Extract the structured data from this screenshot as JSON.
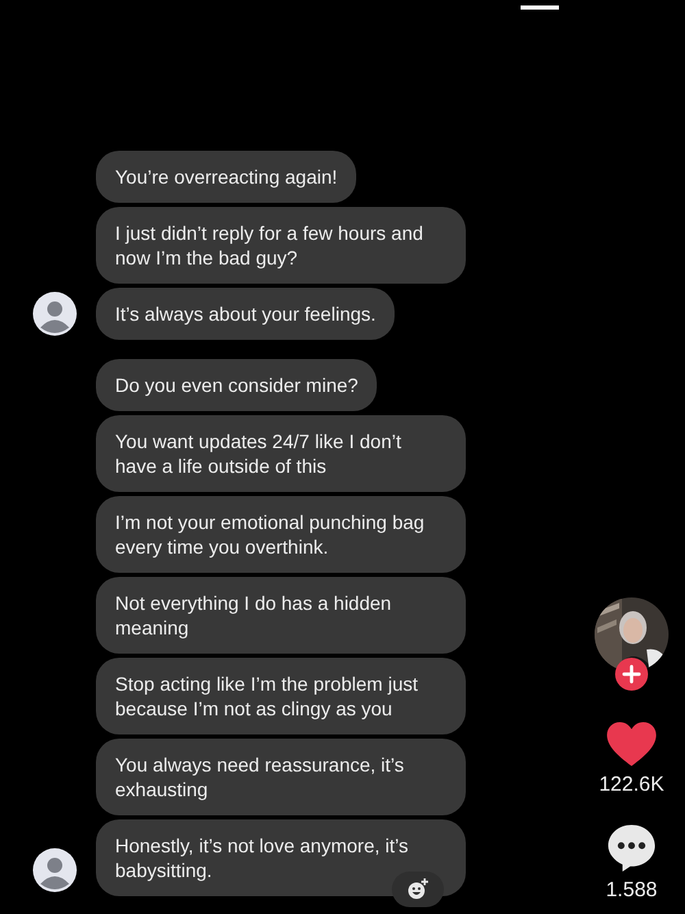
{
  "conversation": [
    {
      "messages": [
        "You’re overreacting again!",
        "I just didn’t reply for a few hours and now I’m the bad guy?",
        "It’s always about your feelings."
      ]
    },
    {
      "messages": [
        "Do you even consider mine?",
        "You want updates 24/7 like I don’t have a life outside of this",
        "I’m not your emotional punching bag every time you overthink.",
        "Not everything I do has a hidden meaning",
        "Stop acting like I’m the problem just because I’m not as clingy as you",
        "You always need reassurance, it’s exhausting",
        "Honestly, it’s not love anymore, it’s babysitting."
      ]
    }
  ],
  "side_actions": {
    "likes": "122.6K",
    "comments": "1.588"
  }
}
